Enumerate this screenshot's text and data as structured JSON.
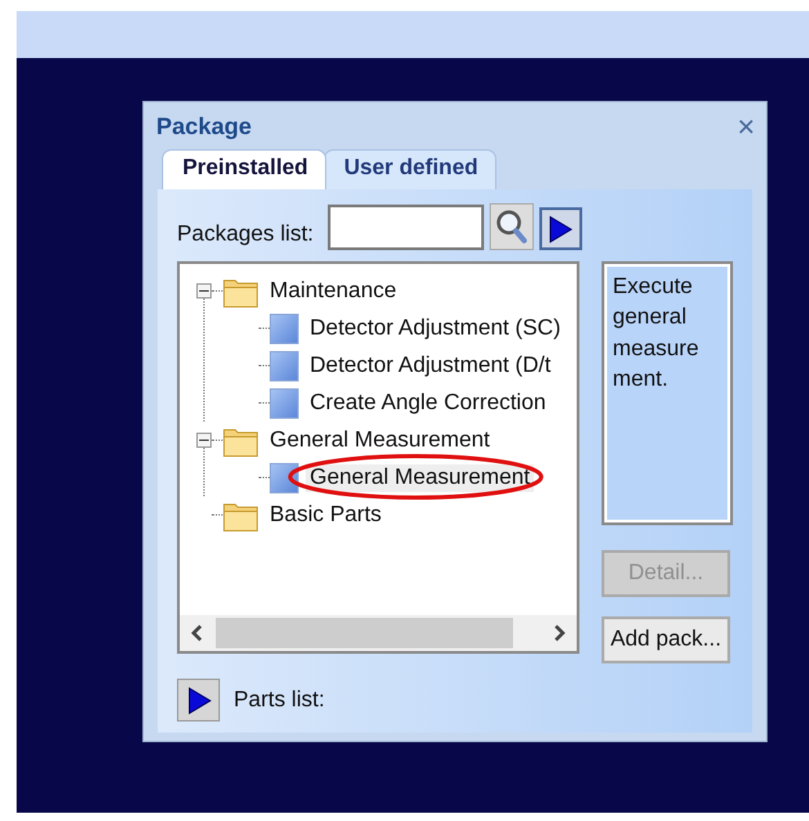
{
  "window": {
    "title": "Package",
    "close": "×"
  },
  "tabs": [
    {
      "label": "Preinstalled",
      "selected": true
    },
    {
      "label": "User defined",
      "selected": false
    }
  ],
  "packages_list": {
    "label": "Packages list:"
  },
  "tree": [
    {
      "label": "Maintenance",
      "kind": "folder",
      "expanded": true,
      "selected": false,
      "annotated": false,
      "children": [
        {
          "label": "Detector Adjustment (SC)",
          "kind": "package",
          "selected": false,
          "annotated": false
        },
        {
          "label": "Detector Adjustment (D/t",
          "kind": "package",
          "selected": false,
          "annotated": false
        },
        {
          "label": "Create Angle Correction",
          "kind": "package",
          "selected": false,
          "annotated": false
        }
      ]
    },
    {
      "label": "General Measurement",
      "kind": "folder",
      "expanded": true,
      "selected": false,
      "annotated": false,
      "children": [
        {
          "label": "General Measurement",
          "kind": "package",
          "selected": true,
          "annotated": true
        }
      ]
    },
    {
      "label": "Basic Parts",
      "kind": "folder",
      "selected": false,
      "annotated": false
    }
  ],
  "description": "Execute general measurement.",
  "buttons": [
    {
      "label": "Detail...",
      "disabled": true
    },
    {
      "label": "Add pack...",
      "disabled": false
    }
  ],
  "parts_list": {
    "label": "Parts list:"
  }
}
